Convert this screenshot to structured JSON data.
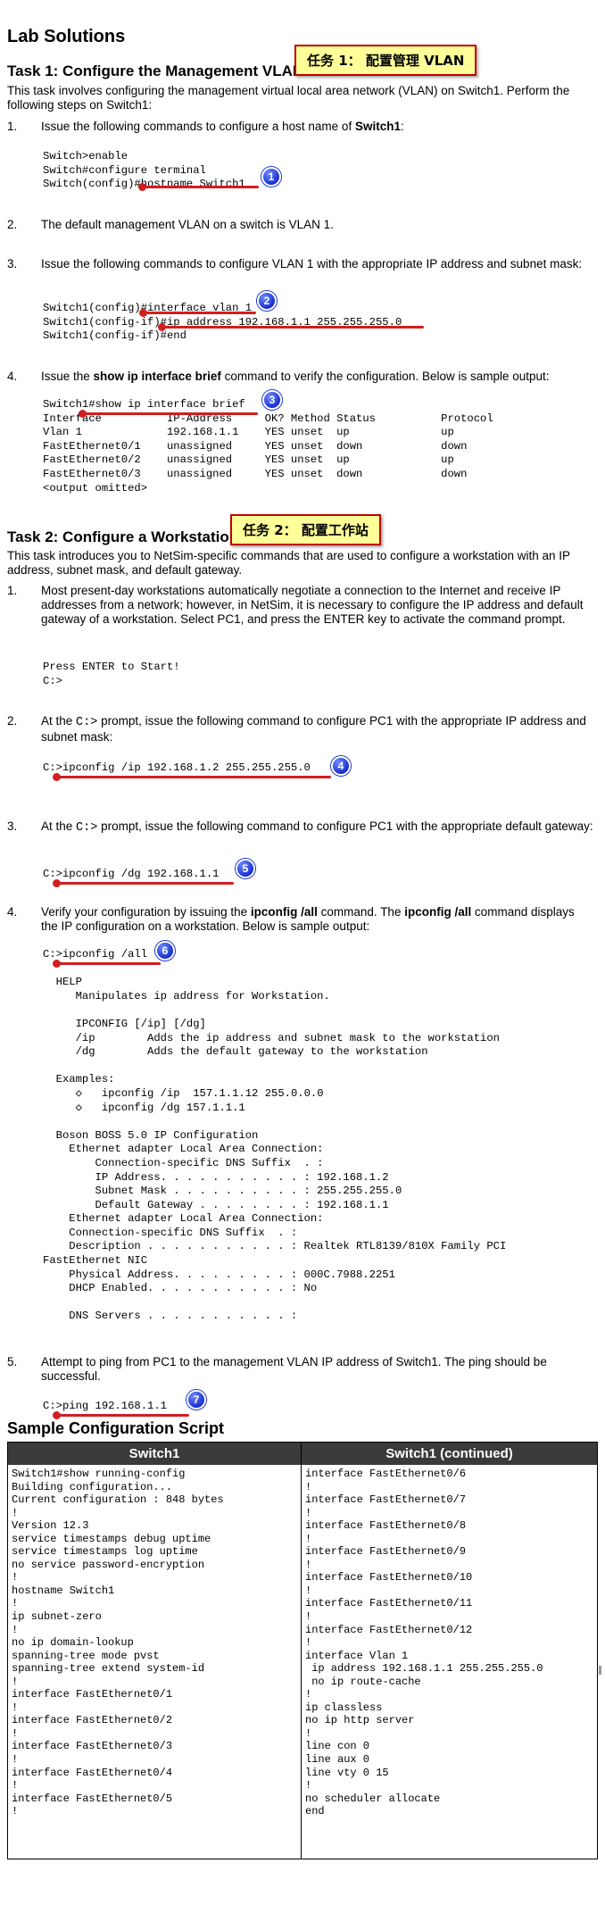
{
  "title": "Lab Solutions",
  "task1": {
    "heading": "Task 1: Configure the Management VLAN",
    "callout": "任务 1： 配置管理 VLAN",
    "intro": "This task involves configuring the management virtual local area network (VLAN) on Switch1. Perform the following steps on Switch1:",
    "steps": [
      {
        "num": "1.",
        "text_before": "Issue the following commands to configure a host name of ",
        "bold": "Switch1",
        "text_after": ":",
        "code": "Switch>enable\nSwitch#configure terminal\nSwitch(config)#hostname Switch1"
      },
      {
        "num": "2.",
        "text": "The default management VLAN on a switch is VLAN 1."
      },
      {
        "num": "3.",
        "text": "Issue the following commands to configure VLAN 1 with the appropriate IP address and subnet mask:",
        "code": "Switch1(config)#interface vlan 1\nSwitch1(config-if)#ip address 192.168.1.1 255.255.255.0\nSwitch1(config-if)#end"
      },
      {
        "num": "4.",
        "text_before": "Issue the ",
        "bold": "show ip interface brief",
        "text_after": " command to verify the configuration. Below is sample output:",
        "code": "Switch1#show ip interface brief\nInterface          IP-Address     OK? Method Status          Protocol\nVlan 1             192.168.1.1    YES unset  up              up\nFastEthernet0/1    unassigned     YES unset  down            down\nFastEthernet0/2    unassigned     YES unset  up              up\nFastEthernet0/3    unassigned     YES unset  down            down\n<output omitted>"
      }
    ]
  },
  "task2": {
    "heading": "Task 2: Configure a Workstation",
    "callout": "任务 2： 配置工作站",
    "intro": "This task introduces you to NetSim-specific commands that are used to configure a workstation with an IP address, subnet mask, and default gateway.",
    "steps": [
      {
        "num": "1.",
        "text": "Most present-day workstations automatically negotiate a connection to the Internet and receive IP addresses from a network; however, in NetSim, it is necessary to configure the IP address and default gateway of a workstation. Select PC1, and press the ENTER key to activate the command prompt.",
        "code": "Press ENTER to Start!\nC:>"
      },
      {
        "num": "2.",
        "text_before": "At the ",
        "mono": "C:>",
        "text_after": " prompt, issue the following command to configure PC1 with the appropriate IP address and subnet mask:",
        "code": "C:>ipconfig /ip 192.168.1.2 255.255.255.0"
      },
      {
        "num": "3.",
        "text_before": "At the ",
        "mono": "C:>",
        "text_after": " prompt, issue the following command to configure PC1 with the appropriate default gateway:",
        "code": "C:>ipconfig /dg 192.168.1.1"
      },
      {
        "num": "4.",
        "text_before": "Verify your configuration by issuing the ",
        "bold": "ipconfig /all",
        "text_mid": " command. The ",
        "bold2": "ipconfig /all",
        "text_after": " command displays the IP configuration on a workstation. Below is sample output:",
        "code": "C:>ipconfig /all\n\n  HELP\n     Manipulates ip address for Workstation.\n\n     IPCONFIG [/ip] [/dg]\n     /ip        Adds the ip address and subnet mask to the workstation\n     /dg        Adds the default gateway to the workstation\n\n  Examples:\n     ◇   ipconfig /ip  157.1.1.12 255.0.0.0\n     ◇   ipconfig /dg 157.1.1.1\n\n  Boson BOSS 5.0 IP Configuration\n    Ethernet adapter Local Area Connection:\n        Connection-specific DNS Suffix  . :\n        IP Address. . . . . . . . . . . : 192.168.1.2\n        Subnet Mask . . . . . . . . . . : 255.255.255.0\n        Default Gateway . . . . . . . . : 192.168.1.1\n    Ethernet adapter Local Area Connection:\n    Connection-specific DNS Suffix  . :\n    Description . . . . . . . . . . . : Realtek RTL8139/810X Family PCI\nFastEthernet NIC\n    Physical Address. . . . . . . . . : 000C.7988.2251\n    DHCP Enabled. . . . . . . . . . . : No\n\n    DNS Servers . . . . . . . . . . . :"
      },
      {
        "num": "5.",
        "text": "Attempt to ping from PC1 to the management VLAN IP address of Switch1. The ping should be successful.",
        "code": "C:>ping 192.168.1.1"
      }
    ]
  },
  "badges": [
    "1",
    "2",
    "3",
    "4",
    "5",
    "6",
    "7"
  ],
  "sample": {
    "heading": "Sample Configuration Script",
    "col1_header": "Switch1",
    "col2_header": "Switch1 (continued)",
    "col1": "Switch1#show running-config\nBuilding configuration...\nCurrent configuration : 848 bytes\n!\nVersion 12.3\nservice timestamps debug uptime\nservice timestamps log uptime\nno service password-encryption\n!\nhostname Switch1\n!\nip subnet-zero\n!\nno ip domain-lookup\nspanning-tree mode pvst\nspanning-tree extend system-id\n!\ninterface FastEthernet0/1\n!\ninterface FastEthernet0/2\n!\ninterface FastEthernet0/3\n!\ninterface FastEthernet0/4\n!\ninterface FastEthernet0/5\n!",
    "col2": "interface FastEthernet0/6\n!\ninterface FastEthernet0/7\n!\ninterface FastEthernet0/8\n!\ninterface FastEthernet0/9\n!\ninterface FastEthernet0/10\n!\ninterface FastEthernet0/11\n!\ninterface FastEthernet0/12\n!\ninterface Vlan 1\n ip address 192.168.1.1 255.255.255.0\n no ip route-cache\n!\nip classless\nno ip http server\n!\nline con 0\nline aux 0\nline vty 0 15\n!\nno scheduler allocate\nend"
  },
  "colors": {
    "accent_red": "#d21e1e",
    "callout_bg": "#ffff99",
    "badge_blue": "#1a2fd0",
    "table_header": "#3a3a3a"
  }
}
